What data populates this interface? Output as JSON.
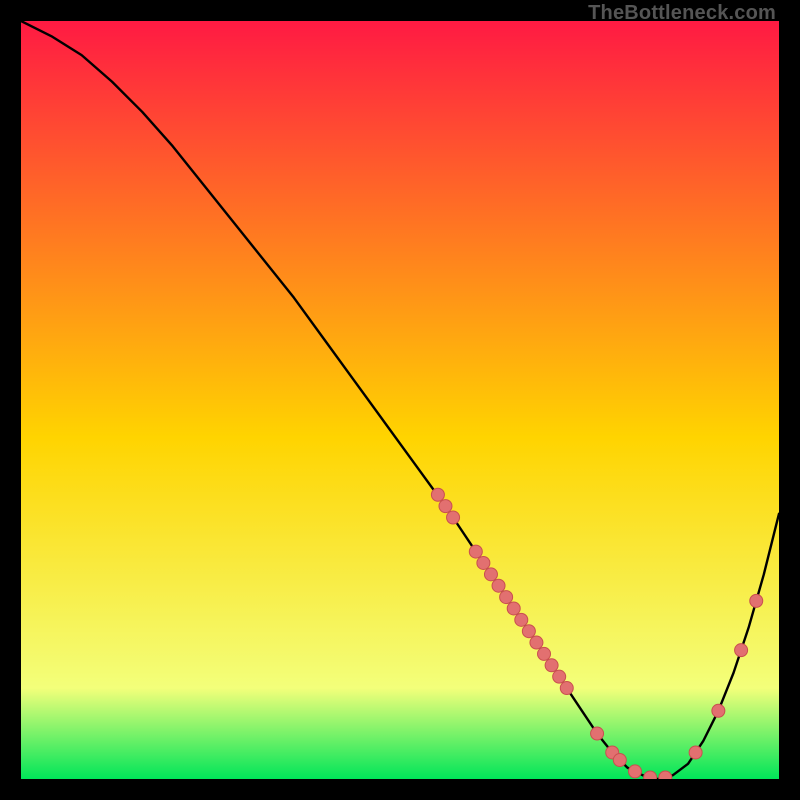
{
  "watermark": "TheBottleneck.com",
  "colors": {
    "grad_top": "#ff1a43",
    "grad_mid": "#ffd400",
    "grad_bottom": "#00e559",
    "curve": "#000000",
    "marker_fill": "#e27070",
    "marker_stroke": "#c94f4f",
    "frame": "#000000"
  },
  "chart_data": {
    "type": "line",
    "title": "",
    "xlabel": "",
    "ylabel": "",
    "xlim": [
      0,
      100
    ],
    "ylim": [
      0,
      100
    ],
    "grid": false,
    "legend": false,
    "series": [
      {
        "name": "bottleneck-curve",
        "x": [
          0,
          4,
          8,
          12,
          16,
          20,
          24,
          28,
          32,
          36,
          40,
          44,
          48,
          52,
          56,
          58,
          60,
          62,
          64,
          66,
          68,
          70,
          72,
          74,
          76,
          78,
          80,
          82,
          84,
          86,
          88,
          90,
          92,
          94,
          96,
          98,
          100
        ],
        "y": [
          100,
          98,
          95.5,
          92,
          88,
          83.5,
          78.5,
          73.5,
          68.5,
          63.5,
          58,
          52.5,
          47,
          41.5,
          36,
          33,
          30,
          27,
          24,
          21,
          18,
          15,
          12,
          9,
          6,
          3.5,
          1.5,
          0.5,
          0,
          0.5,
          2,
          5,
          9,
          14,
          20,
          27,
          35
        ]
      }
    ],
    "markers": {
      "name": "sample-points",
      "points": [
        {
          "x": 55,
          "y": 37.5
        },
        {
          "x": 56,
          "y": 36
        },
        {
          "x": 57,
          "y": 34.5
        },
        {
          "x": 60,
          "y": 30
        },
        {
          "x": 61,
          "y": 28.5
        },
        {
          "x": 62,
          "y": 27
        },
        {
          "x": 63,
          "y": 25.5
        },
        {
          "x": 64,
          "y": 24
        },
        {
          "x": 65,
          "y": 22.5
        },
        {
          "x": 66,
          "y": 21
        },
        {
          "x": 67,
          "y": 19.5
        },
        {
          "x": 68,
          "y": 18
        },
        {
          "x": 69,
          "y": 16.5
        },
        {
          "x": 70,
          "y": 15
        },
        {
          "x": 71,
          "y": 13.5
        },
        {
          "x": 72,
          "y": 12
        },
        {
          "x": 76,
          "y": 6
        },
        {
          "x": 78,
          "y": 3.5
        },
        {
          "x": 79,
          "y": 2.5
        },
        {
          "x": 81,
          "y": 1
        },
        {
          "x": 83,
          "y": 0.2
        },
        {
          "x": 85,
          "y": 0.2
        },
        {
          "x": 89,
          "y": 3.5
        },
        {
          "x": 92,
          "y": 9
        },
        {
          "x": 95,
          "y": 17
        },
        {
          "x": 97,
          "y": 23.5
        }
      ]
    }
  }
}
